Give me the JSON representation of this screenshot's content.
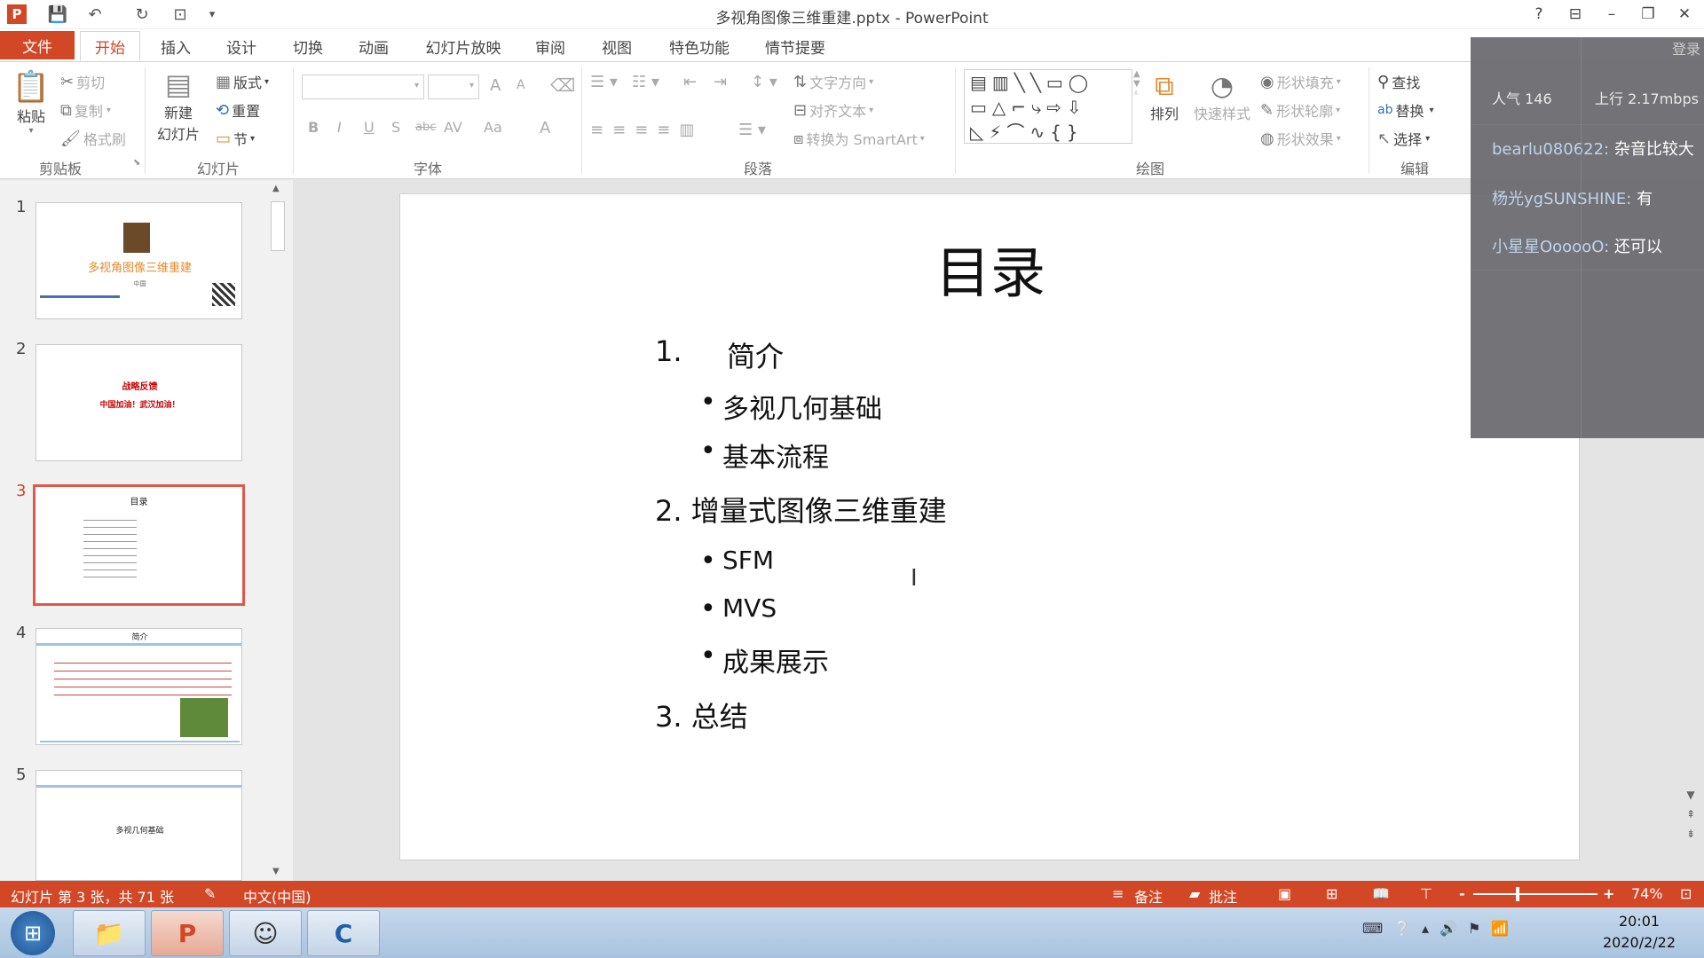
{
  "window": {
    "title": "多视角图像三维重建.pptx - PowerPoint",
    "help": "?",
    "minimize": "–",
    "restore": "❐",
    "close": "✕",
    "signin": "登录"
  },
  "quick_access": {
    "app_icon": "P",
    "save": "💾",
    "undo": "↶",
    "redo": "↻",
    "present": "⊡",
    "more": "▾"
  },
  "tabs": [
    "文件",
    "开始",
    "插入",
    "设计",
    "切换",
    "动画",
    "幻灯片放映",
    "审阅",
    "视图",
    "特色功能",
    "情节提要"
  ],
  "active_tab": "开始",
  "ribbon": {
    "clipboard": {
      "paste": "粘贴",
      "cut": "剪切",
      "copy": "复制",
      "format_painter": "格式刷",
      "label": "剪贴板"
    },
    "slides": {
      "new_slide_1": "新建",
      "new_slide_2": "幻灯片",
      "layout": "版式",
      "reset": "重置",
      "section": "节",
      "label": "幻灯片"
    },
    "font": {
      "bold": "B",
      "italic": "I",
      "underline": "U",
      "shadow": "S",
      "strike": "abc",
      "spacing": "AV",
      "case": "Aa",
      "color": "A",
      "grow": "A",
      "shrink": "A",
      "label": "字体"
    },
    "paragraph": {
      "text_direction": "文字方向",
      "align_text": "对齐文本",
      "smartart": "转换为 SmartArt",
      "label": "段落"
    },
    "drawing": {
      "arrange": "排列",
      "quick_styles": "快速样式",
      "shape_fill": "形状填充",
      "shape_outline": "形状轮廓",
      "shape_effects": "形状效果",
      "label": "绘图"
    },
    "editing": {
      "find": "查找",
      "replace": "替换",
      "select": "选择",
      "label": "编辑"
    }
  },
  "thumbnails": [
    {
      "num": "1",
      "title": "多视角图像三维重建",
      "sub": "中国"
    },
    {
      "num": "2",
      "title": "战略反馈",
      "sub": "中国加油！武汉加油！"
    },
    {
      "num": "3",
      "title": "目录"
    },
    {
      "num": "4",
      "title": "简介"
    },
    {
      "num": "5",
      "title": "多视几何基础"
    }
  ],
  "slide": {
    "title": "目录",
    "item1_num": "1.",
    "item1": "简介",
    "b1": "多视几何基础",
    "b2": "基本流程",
    "item2": "2. 增量式图像三维重建",
    "b3": "SFM",
    "b4": "MVS",
    "b5": "成果展示",
    "item3": "3. 总结",
    "bullet_char": "•"
  },
  "status": {
    "slide_info": "幻灯片 第 3 张，共 71 张",
    "language": "中文(中国)",
    "notes": "备注",
    "comments": "批注",
    "zoom_minus": "-",
    "zoom_plus": "+",
    "zoom": "74%",
    "zoom_level": 0.74
  },
  "overlay": {
    "popularity": "人气 146",
    "upload": "上行 2.17mbps",
    "chat": [
      {
        "user": "bearlu080622:",
        "msg": "杂音比较大"
      },
      {
        "user": "杨光ygSUNSHINE:",
        "msg": "有"
      },
      {
        "user": "小星星OooooO:",
        "msg": "还可以"
      }
    ]
  },
  "taskbar": {
    "time": "20:01",
    "date": "2020/2/22"
  },
  "colors": {
    "accent": "#d24726",
    "selected_thumb": "#e0584a"
  }
}
